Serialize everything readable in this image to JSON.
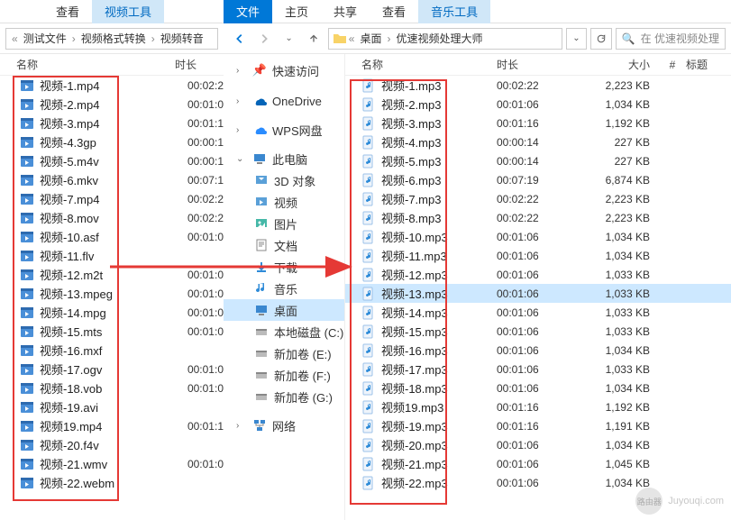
{
  "ribbon_left": {
    "tabs": [
      "查看",
      "视频工具"
    ]
  },
  "ribbon_right": {
    "tabs": [
      "文件",
      "主页",
      "共享",
      "查看",
      "音乐工具"
    ],
    "active": 0,
    "highlight": 4
  },
  "nav_left": {
    "crumbs": [
      "测试文件",
      "视频格式转换",
      "视频转音"
    ]
  },
  "nav_right": {
    "crumbs_prefix": "«",
    "crumbs": [
      "桌面",
      "优速视频处理大师"
    ],
    "search_placeholder": "在 优速视频处理"
  },
  "cols": {
    "name": "名称",
    "dur": "时长",
    "size": "大小",
    "num": "#",
    "title": "标题"
  },
  "tree": {
    "quick": "快速访问",
    "onedrive": "OneDrive",
    "wps": "WPS网盘",
    "pc": "此电脑",
    "pc_children": [
      "3D 对象",
      "视频",
      "图片",
      "文档",
      "下载",
      "音乐",
      "桌面",
      "本地磁盘 (C:)",
      "新加卷 (E:)",
      "新加卷 (F:)",
      "新加卷 (G:)"
    ],
    "selected_child": 6,
    "network": "网络"
  },
  "left_files": [
    {
      "name": "视频-1.mp4",
      "dur": "00:02:2"
    },
    {
      "name": "视频-2.mp4",
      "dur": "00:01:0"
    },
    {
      "name": "视频-3.mp4",
      "dur": "00:01:1"
    },
    {
      "name": "视频-4.3gp",
      "dur": "00:00:1"
    },
    {
      "name": "视频-5.m4v",
      "dur": "00:00:1"
    },
    {
      "name": "视频-6.mkv",
      "dur": "00:07:1"
    },
    {
      "name": "视频-7.mp4",
      "dur": "00:02:2"
    },
    {
      "name": "视频-8.mov",
      "dur": "00:02:2"
    },
    {
      "name": "视频-10.asf",
      "dur": "00:01:0"
    },
    {
      "name": "视频-11.flv",
      "dur": ""
    },
    {
      "name": "视频-12.m2t",
      "dur": "00:01:0"
    },
    {
      "name": "视频-13.mpeg",
      "dur": "00:01:0"
    },
    {
      "name": "视频-14.mpg",
      "dur": "00:01:0"
    },
    {
      "name": "视频-15.mts",
      "dur": "00:01:0"
    },
    {
      "name": "视频-16.mxf",
      "dur": ""
    },
    {
      "name": "视频-17.ogv",
      "dur": "00:01:0"
    },
    {
      "name": "视频-18.vob",
      "dur": "00:01:0"
    },
    {
      "name": "视频-19.avi",
      "dur": ""
    },
    {
      "name": "视频19.mp4",
      "dur": "00:01:1"
    },
    {
      "name": "视频-20.f4v",
      "dur": ""
    },
    {
      "name": "视频-21.wmv",
      "dur": "00:01:0"
    },
    {
      "name": "视频-22.webm",
      "dur": ""
    }
  ],
  "right_files": [
    {
      "name": "视频-1.mp3",
      "dur": "00:02:22",
      "size": "2,223 KB"
    },
    {
      "name": "视频-2.mp3",
      "dur": "00:01:06",
      "size": "1,034 KB"
    },
    {
      "name": "视频-3.mp3",
      "dur": "00:01:16",
      "size": "1,192 KB"
    },
    {
      "name": "视频-4.mp3",
      "dur": "00:00:14",
      "size": "227 KB"
    },
    {
      "name": "视频-5.mp3",
      "dur": "00:00:14",
      "size": "227 KB"
    },
    {
      "name": "视频-6.mp3",
      "dur": "00:07:19",
      "size": "6,874 KB"
    },
    {
      "name": "视频-7.mp3",
      "dur": "00:02:22",
      "size": "2,223 KB"
    },
    {
      "name": "视频-8.mp3",
      "dur": "00:02:22",
      "size": "2,223 KB"
    },
    {
      "name": "视频-10.mp3",
      "dur": "00:01:06",
      "size": "1,034 KB"
    },
    {
      "name": "视频-11.mp3",
      "dur": "00:01:06",
      "size": "1,034 KB"
    },
    {
      "name": "视频-12.mp3",
      "dur": "00:01:06",
      "size": "1,033 KB"
    },
    {
      "name": "视频-13.mp3",
      "dur": "00:01:06",
      "size": "1,033 KB",
      "selected": true
    },
    {
      "name": "视频-14.mp3",
      "dur": "00:01:06",
      "size": "1,033 KB"
    },
    {
      "name": "视频-15.mp3",
      "dur": "00:01:06",
      "size": "1,033 KB"
    },
    {
      "name": "视频-16.mp3",
      "dur": "00:01:06",
      "size": "1,034 KB"
    },
    {
      "name": "视频-17.mp3",
      "dur": "00:01:06",
      "size": "1,033 KB"
    },
    {
      "name": "视频-18.mp3",
      "dur": "00:01:06",
      "size": "1,034 KB"
    },
    {
      "name": "视频19.mp3",
      "dur": "00:01:16",
      "size": "1,192 KB"
    },
    {
      "name": "视频-19.mp3",
      "dur": "00:01:16",
      "size": "1,191 KB"
    },
    {
      "name": "视频-20.mp3",
      "dur": "00:01:06",
      "size": "1,034 KB"
    },
    {
      "name": "视频-21.mp3",
      "dur": "00:01:06",
      "size": "1,045 KB"
    },
    {
      "name": "视频-22.mp3",
      "dur": "00:01:06",
      "size": "1,034 KB"
    }
  ],
  "watermark": {
    "circle": "路由器",
    "text": "Juyouqi.com"
  },
  "icons": {
    "search": "🔍",
    "refresh": "↻",
    "dropdown": "⌄"
  }
}
